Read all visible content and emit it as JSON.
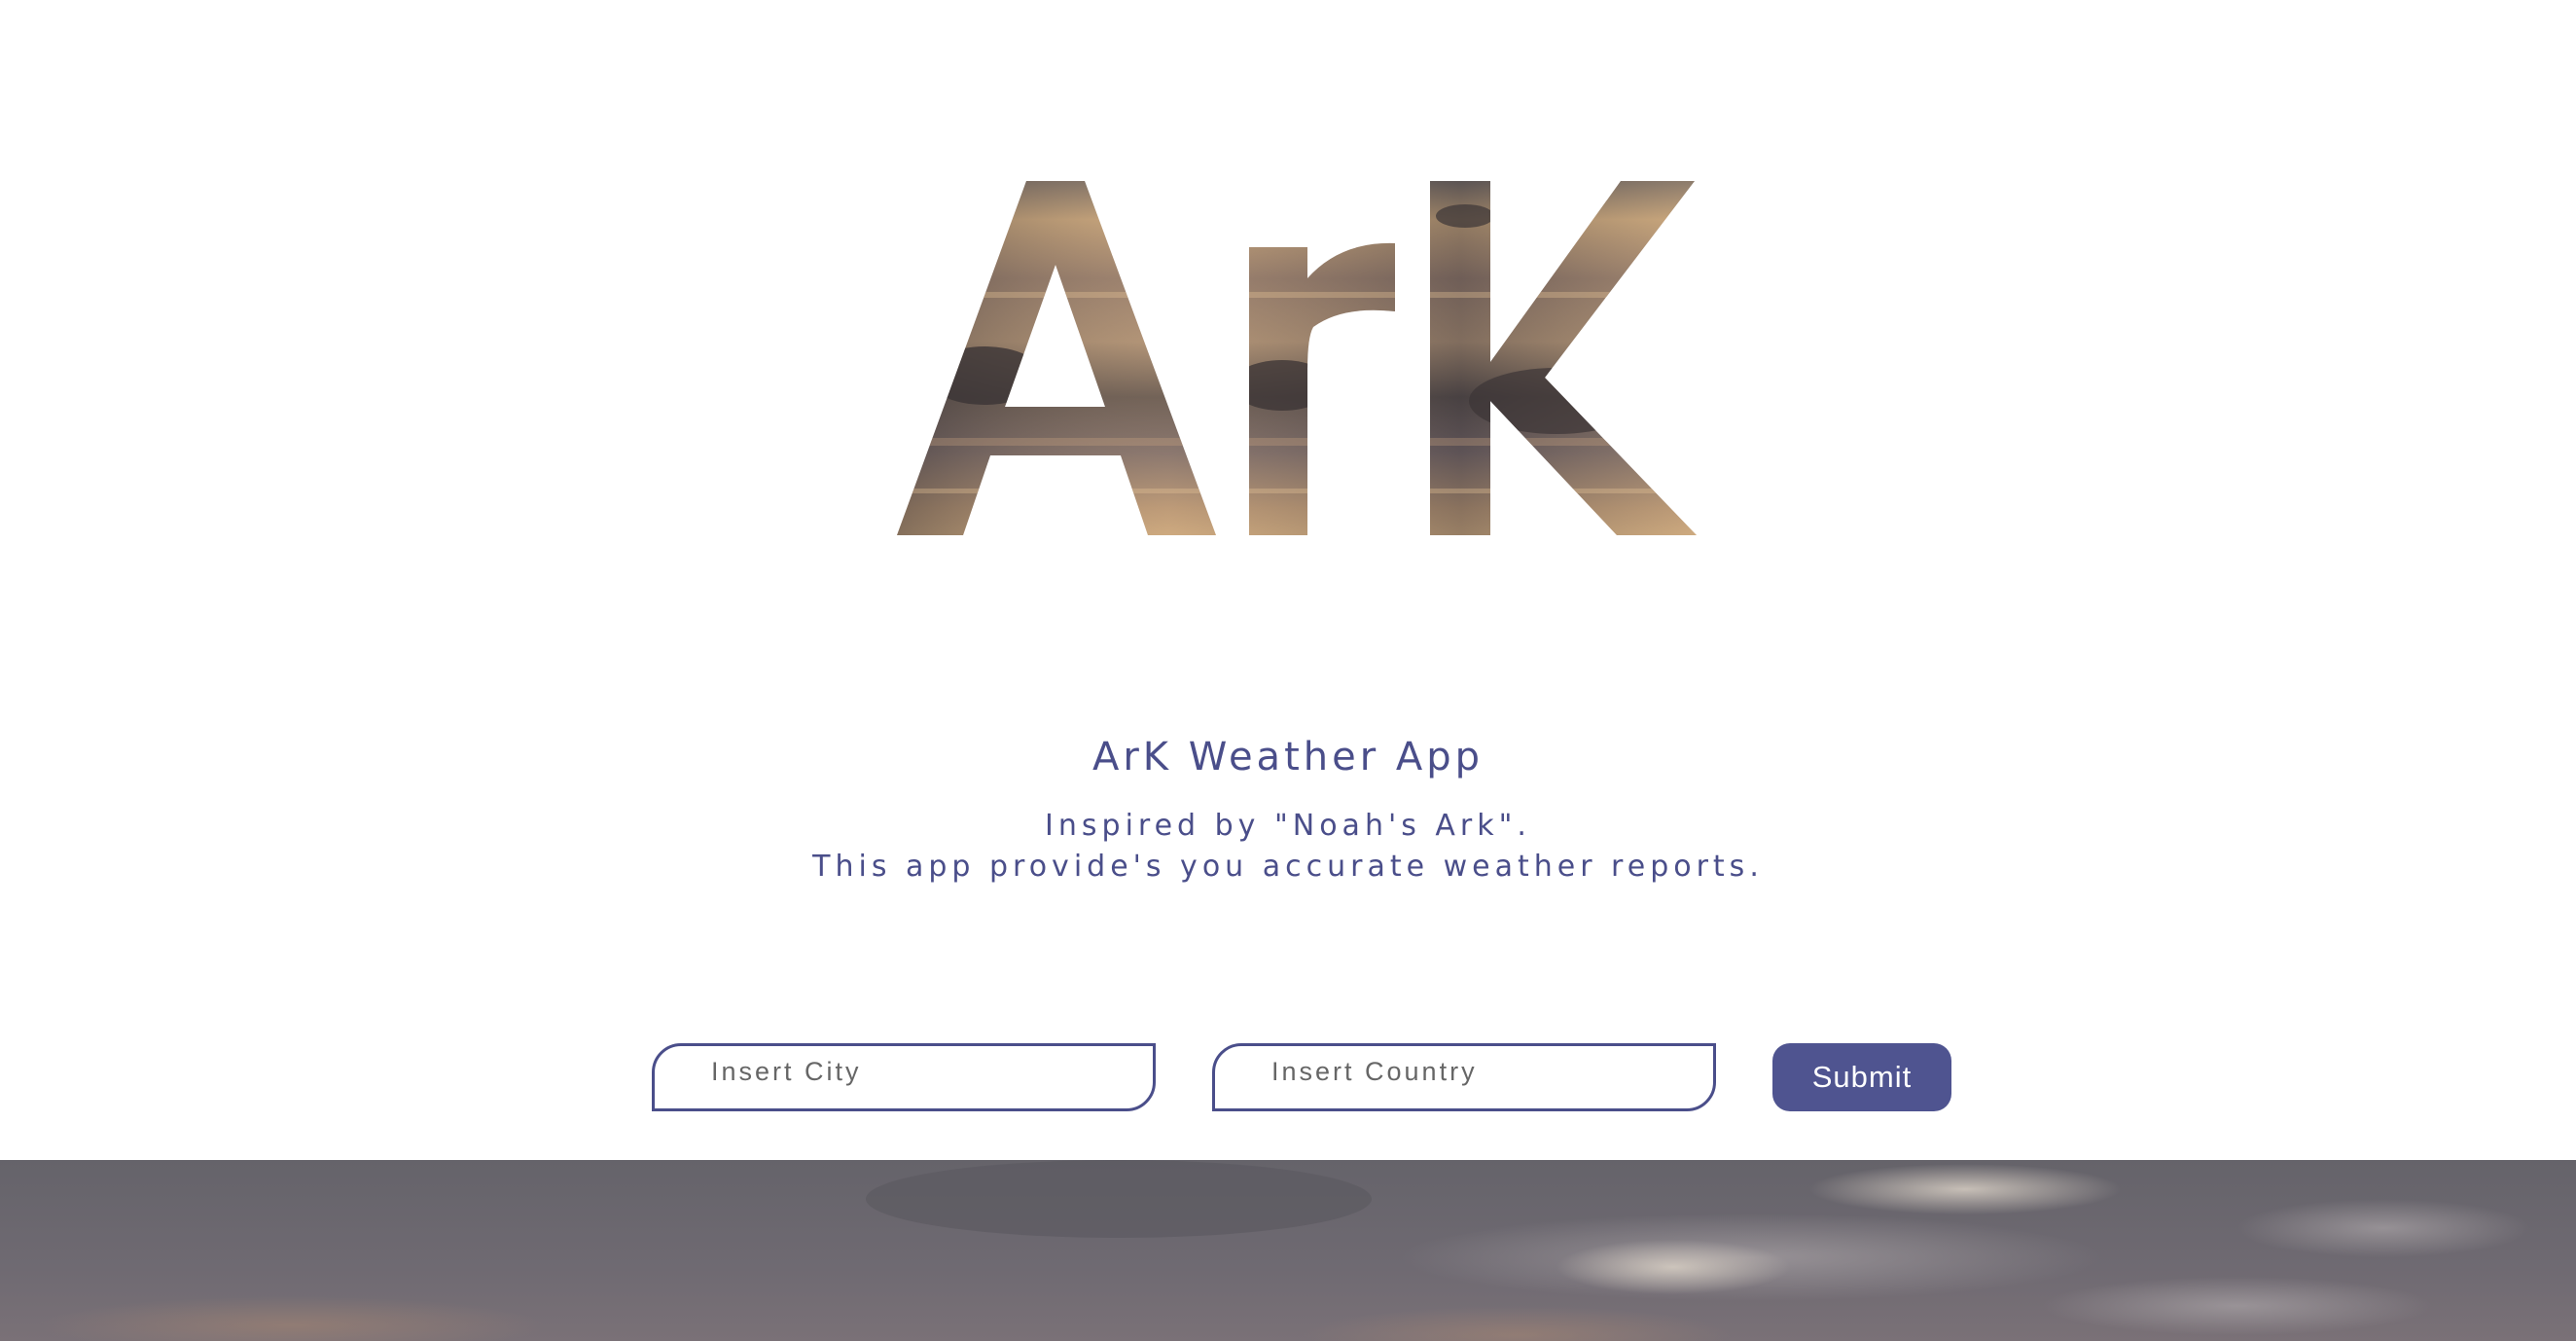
{
  "logo": {
    "text": "ArK"
  },
  "header": {
    "title": "ArK Weather App",
    "description_line1": "Inspired by \"Noah's Ark\".",
    "description_line2": "This app provide's you accurate weather reports."
  },
  "form": {
    "city_placeholder": "Insert City",
    "city_value": "",
    "country_placeholder": "Insert Country",
    "country_value": "",
    "submit_label": "Submit"
  },
  "colors": {
    "accent": "#4a4e8a",
    "button": "#4f5490",
    "background": "#ffffff"
  }
}
